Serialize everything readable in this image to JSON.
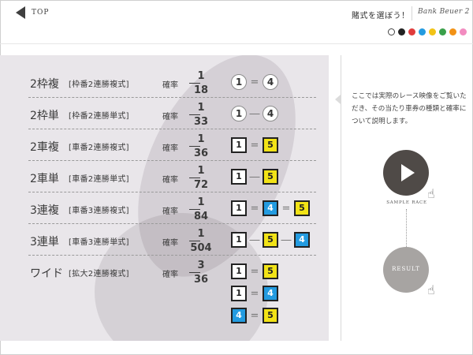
{
  "header": {
    "top_label": "TOP",
    "title": "賭式を選ぼう！",
    "logo": "Bank Beuer 2",
    "color_dots": [
      "#ffffff",
      "#222222",
      "#e03c3c",
      "#239be0",
      "#f2c316",
      "#3aa04a",
      "#f29216",
      "#f28cc0"
    ]
  },
  "rows": [
    {
      "name": "2枠複",
      "sub": "[枠番2連勝複式]",
      "prob": "確率",
      "num": "1",
      "den": "18",
      "combo": [
        {
          "t": "c",
          "v": "1"
        },
        {
          "t": "o",
          "v": "="
        },
        {
          "t": "c",
          "v": "4"
        }
      ]
    },
    {
      "name": "2枠単",
      "sub": "[枠番2連勝単式]",
      "prob": "確率",
      "num": "1",
      "den": "33",
      "combo": [
        {
          "t": "c",
          "v": "1"
        },
        {
          "t": "o",
          "v": "―"
        },
        {
          "t": "c",
          "v": "4"
        }
      ]
    },
    {
      "name": "2車複",
      "sub": "[車番2連勝複式]",
      "prob": "確率",
      "num": "1",
      "den": "36",
      "combo": [
        {
          "t": "s",
          "c": "white",
          "v": "1"
        },
        {
          "t": "o",
          "v": "="
        },
        {
          "t": "s",
          "c": "yellow",
          "v": "5"
        }
      ]
    },
    {
      "name": "2車単",
      "sub": "[車番2連勝単式]",
      "prob": "確率",
      "num": "1",
      "den": "72",
      "combo": [
        {
          "t": "s",
          "c": "white",
          "v": "1"
        },
        {
          "t": "o",
          "v": "―"
        },
        {
          "t": "s",
          "c": "yellow",
          "v": "5"
        }
      ]
    },
    {
      "name": "3連複",
      "sub": "[車番3連勝複式]",
      "prob": "確率",
      "num": "1",
      "den": "84",
      "combo": [
        {
          "t": "s",
          "c": "white",
          "v": "1"
        },
        {
          "t": "o",
          "v": "="
        },
        {
          "t": "s",
          "c": "blue",
          "v": "4"
        },
        {
          "t": "o",
          "v": "="
        },
        {
          "t": "s",
          "c": "yellow",
          "v": "5"
        }
      ]
    },
    {
      "name": "3連単",
      "sub": "[車番3連勝単式]",
      "prob": "確率",
      "num": "1",
      "den": "504",
      "combo": [
        {
          "t": "s",
          "c": "white",
          "v": "1"
        },
        {
          "t": "o",
          "v": "―"
        },
        {
          "t": "s",
          "c": "yellow",
          "v": "5"
        },
        {
          "t": "o",
          "v": "―"
        },
        {
          "t": "s",
          "c": "blue",
          "v": "4"
        }
      ]
    }
  ],
  "wide": {
    "name": "ワイド",
    "sub": "[拡大2連勝複式]",
    "prob": "確率",
    "num": "3",
    "den": "36",
    "combos": [
      [
        {
          "t": "s",
          "c": "white",
          "v": "1"
        },
        {
          "t": "o",
          "v": "="
        },
        {
          "t": "s",
          "c": "yellow",
          "v": "5"
        }
      ],
      [
        {
          "t": "s",
          "c": "white",
          "v": "1"
        },
        {
          "t": "o",
          "v": "="
        },
        {
          "t": "s",
          "c": "blue",
          "v": "4"
        }
      ],
      [
        {
          "t": "s",
          "c": "blue",
          "v": "4"
        },
        {
          "t": "o",
          "v": "="
        },
        {
          "t": "s",
          "c": "yellow",
          "v": "5"
        }
      ]
    ]
  },
  "description": "ここでは実際のレース映像をご覧いただき、その当たり車券の種類と確率について説明します。",
  "sample_race_label": "SAMPLE RACE",
  "result_label": "RESULT"
}
